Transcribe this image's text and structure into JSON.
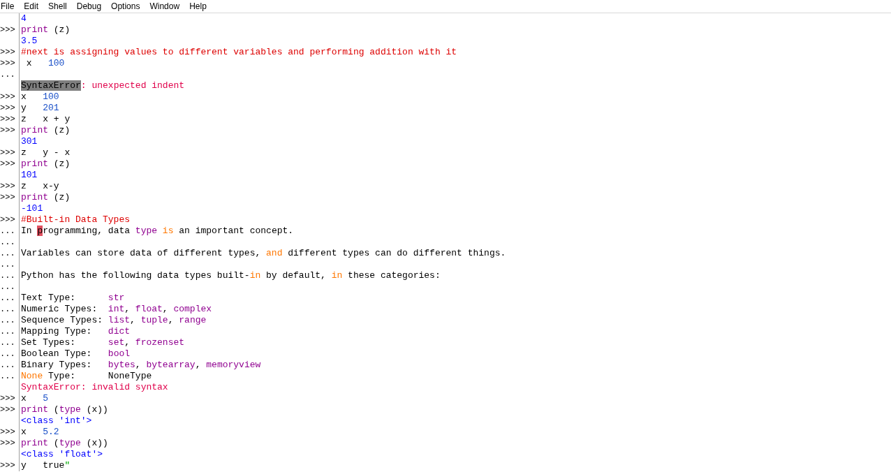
{
  "menu": [
    "File",
    "Edit",
    "Shell",
    "Debug",
    "Options",
    "Window",
    "Help"
  ],
  "lines": [
    {
      "segments": [
        {
          "t": "4",
          "kind": "output"
        }
      ]
    },
    {
      "prompt": ">>>",
      "segments": [
        {
          "t": "print",
          "kind": "builtin"
        },
        {
          "t": " (z)",
          "kind": "plain"
        }
      ]
    },
    {
      "segments": [
        {
          "t": "3.5",
          "kind": "output"
        }
      ]
    },
    {
      "prompt": ">>>",
      "segments": [
        {
          "t": "#next is assigning values to different variables and performing addition with it",
          "kind": "comment"
        }
      ]
    },
    {
      "prompt": ">>>",
      "segments": [
        {
          "t": " x   ",
          "kind": "plain"
        },
        {
          "t": "100",
          "kind": "number"
        }
      ]
    },
    {
      "prompt": "..."
    },
    {
      "segments": [
        {
          "t": "SyntaxError",
          "kind": "errhl"
        },
        {
          "t": ": unexpected indent",
          "kind": "error"
        }
      ]
    },
    {
      "prompt": ">>>",
      "segments": [
        {
          "t": "x   ",
          "kind": "plain"
        },
        {
          "t": "100",
          "kind": "number"
        }
      ]
    },
    {
      "prompt": ">>>",
      "segments": [
        {
          "t": "y   ",
          "kind": "plain"
        },
        {
          "t": "201",
          "kind": "number"
        }
      ]
    },
    {
      "prompt": ">>>",
      "segments": [
        {
          "t": "z   x + y",
          "kind": "plain"
        }
      ]
    },
    {
      "prompt": ">>>",
      "segments": [
        {
          "t": "print",
          "kind": "builtin"
        },
        {
          "t": " (z)",
          "kind": "plain"
        }
      ]
    },
    {
      "segments": [
        {
          "t": "301",
          "kind": "output"
        }
      ]
    },
    {
      "prompt": ">>>",
      "segments": [
        {
          "t": "z   y - x",
          "kind": "plain"
        }
      ]
    },
    {
      "prompt": ">>>",
      "segments": [
        {
          "t": "print",
          "kind": "builtin"
        },
        {
          "t": " (z)",
          "kind": "plain"
        }
      ]
    },
    {
      "segments": [
        {
          "t": "101",
          "kind": "output"
        }
      ]
    },
    {
      "prompt": ">>>",
      "segments": [
        {
          "t": "z   x-y",
          "kind": "plain"
        }
      ]
    },
    {
      "prompt": ">>>",
      "segments": [
        {
          "t": "print",
          "kind": "builtin"
        },
        {
          "t": " (z)",
          "kind": "plain"
        }
      ]
    },
    {
      "segments": [
        {
          "t": "-101",
          "kind": "output"
        }
      ]
    },
    {
      "prompt": ">>>",
      "segments": [
        {
          "t": "#Built-in Data Types",
          "kind": "comment"
        }
      ]
    },
    {
      "prompt": "...",
      "segments": [
        {
          "t": "In ",
          "kind": "plain"
        },
        {
          "t": "p",
          "kind": "sel"
        },
        {
          "t": "rogramming, data ",
          "kind": "plain"
        },
        {
          "t": "type",
          "kind": "builtin"
        },
        {
          "t": " is",
          "kind": "keyword"
        },
        {
          "t": " an important concept.",
          "kind": "plain"
        }
      ]
    },
    {
      "prompt": "..."
    },
    {
      "prompt": "...",
      "segments": [
        {
          "t": "Variables can store data of different types, ",
          "kind": "plain"
        },
        {
          "t": "and",
          "kind": "keyword"
        },
        {
          "t": " different types can do different things.",
          "kind": "plain"
        }
      ]
    },
    {
      "prompt": "..."
    },
    {
      "prompt": "...",
      "segments": [
        {
          "t": "Python has the following data types built-",
          "kind": "plain"
        },
        {
          "t": "in",
          "kind": "keyword"
        },
        {
          "t": " by default, ",
          "kind": "plain"
        },
        {
          "t": "in",
          "kind": "keyword"
        },
        {
          "t": " these categories:",
          "kind": "plain"
        }
      ]
    },
    {
      "prompt": "..."
    },
    {
      "prompt": "...",
      "segments": [
        {
          "t": "Text Type:      ",
          "kind": "plain"
        },
        {
          "t": "str",
          "kind": "builtin"
        }
      ]
    },
    {
      "prompt": "...",
      "segments": [
        {
          "t": "Numeric Types:  ",
          "kind": "plain"
        },
        {
          "t": "int",
          "kind": "builtin"
        },
        {
          "t": ", ",
          "kind": "plain"
        },
        {
          "t": "float",
          "kind": "builtin"
        },
        {
          "t": ", ",
          "kind": "plain"
        },
        {
          "t": "complex",
          "kind": "builtin"
        }
      ]
    },
    {
      "prompt": "...",
      "segments": [
        {
          "t": "Sequence Types: ",
          "kind": "plain"
        },
        {
          "t": "list",
          "kind": "builtin"
        },
        {
          "t": ", ",
          "kind": "plain"
        },
        {
          "t": "tuple",
          "kind": "builtin"
        },
        {
          "t": ", ",
          "kind": "plain"
        },
        {
          "t": "range",
          "kind": "builtin"
        }
      ]
    },
    {
      "prompt": "...",
      "segments": [
        {
          "t": "Mapping Type:   ",
          "kind": "plain"
        },
        {
          "t": "dict",
          "kind": "builtin"
        }
      ]
    },
    {
      "prompt": "...",
      "segments": [
        {
          "t": "Set Types:      ",
          "kind": "plain"
        },
        {
          "t": "set",
          "kind": "builtin"
        },
        {
          "t": ", ",
          "kind": "plain"
        },
        {
          "t": "frozenset",
          "kind": "builtin"
        }
      ]
    },
    {
      "prompt": "...",
      "segments": [
        {
          "t": "Boolean Type:   ",
          "kind": "plain"
        },
        {
          "t": "bool",
          "kind": "builtin"
        }
      ]
    },
    {
      "prompt": "...",
      "segments": [
        {
          "t": "Binary Types:   ",
          "kind": "plain"
        },
        {
          "t": "bytes",
          "kind": "builtin"
        },
        {
          "t": ", ",
          "kind": "plain"
        },
        {
          "t": "bytearray",
          "kind": "builtin"
        },
        {
          "t": ", ",
          "kind": "plain"
        },
        {
          "t": "memoryview",
          "kind": "builtin"
        }
      ]
    },
    {
      "prompt": "...",
      "segments": [
        {
          "t": "None",
          "kind": "keyword"
        },
        {
          "t": " Type:      NoneType",
          "kind": "plain"
        }
      ]
    },
    {
      "segments": [
        {
          "t": "SyntaxError: invalid syntax",
          "kind": "error"
        }
      ]
    },
    {
      "prompt": ">>>",
      "segments": [
        {
          "t": "x   ",
          "kind": "plain"
        },
        {
          "t": "5",
          "kind": "number"
        }
      ]
    },
    {
      "prompt": ">>>",
      "segments": [
        {
          "t": "print",
          "kind": "builtin"
        },
        {
          "t": " (",
          "kind": "plain"
        },
        {
          "t": "type",
          "kind": "builtin"
        },
        {
          "t": " (x))",
          "kind": "plain"
        }
      ]
    },
    {
      "segments": [
        {
          "t": "<class 'int'>",
          "kind": "output"
        }
      ]
    },
    {
      "prompt": ">>>",
      "segments": [
        {
          "t": "x   ",
          "kind": "plain"
        },
        {
          "t": "5.2",
          "kind": "number"
        }
      ]
    },
    {
      "prompt": ">>>",
      "segments": [
        {
          "t": "print",
          "kind": "builtin"
        },
        {
          "t": " (",
          "kind": "plain"
        },
        {
          "t": "type",
          "kind": "builtin"
        },
        {
          "t": " (x))",
          "kind": "plain"
        }
      ]
    },
    {
      "segments": [
        {
          "t": "<class 'float'>",
          "kind": "output"
        }
      ]
    },
    {
      "prompt": ">>>",
      "segments": [
        {
          "t": "y   true",
          "kind": "plain"
        },
        {
          "t": "\"",
          "kind": "string"
        }
      ]
    }
  ]
}
